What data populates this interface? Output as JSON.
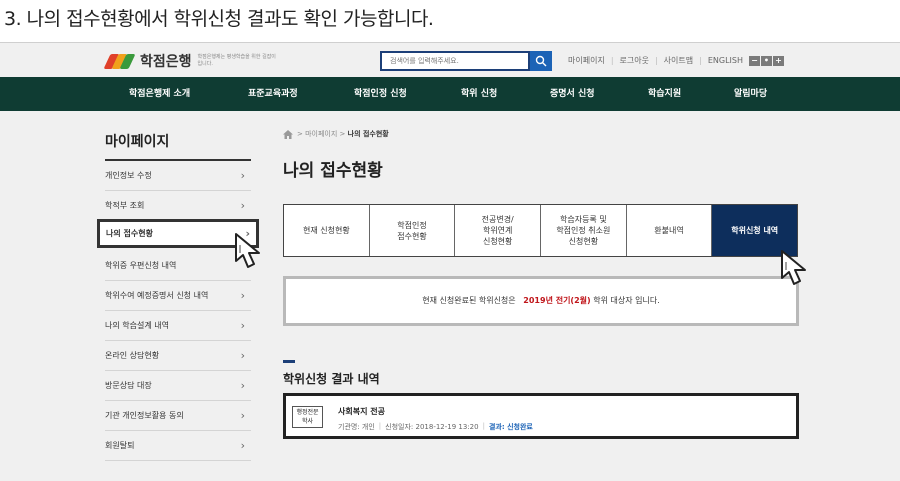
{
  "caption": "3. 나의 접수현황에서 학위신청 결과도 확인 가능합니다.",
  "header": {
    "logo": "학점은행",
    "logo_sub": "학점은행제는 평생학습을 위한 길잡이 입니다.",
    "search_placeholder": "검색어를 입력해주세요.",
    "util": [
      "마이페이지",
      "로그아웃",
      "사이트맵",
      "ENGLISH"
    ],
    "zoom": [
      "−",
      "•",
      "+"
    ]
  },
  "nav": [
    "학점은행제 소개",
    "표준교육과정",
    "학점인정 신청",
    "학위 신청",
    "증명서 신청",
    "학습지원",
    "알림마당"
  ],
  "sidebar": {
    "title": "마이페이지",
    "items": [
      {
        "label": "개인정보 수정",
        "chev": "›"
      },
      {
        "label": "학적부 조회",
        "chev": "›"
      },
      {
        "label": "나의 접수현황",
        "chev": "›"
      },
      {
        "label": "학위증 우편신청 내역",
        "chev": ""
      },
      {
        "label": "학위수여 예정증명서 신청 내역",
        "chev": "›"
      },
      {
        "label": "나의 학습설계 내역",
        "chev": "›"
      },
      {
        "label": "온라인 상담현황",
        "chev": "›"
      },
      {
        "label": "방문상담 대장",
        "chev": "›"
      },
      {
        "label": "기관 개인정보활용 동의",
        "chev": "›"
      },
      {
        "label": "회원탈퇴",
        "chev": "›"
      }
    ]
  },
  "breadcrumb": {
    "sep": ">",
    "parent": "마이페이지",
    "current": "나의 접수현황"
  },
  "page_title": "나의 접수현황",
  "tabs": [
    "현재 신청현황",
    "학점인정\n접수현황",
    "전공변경/\n학위연계\n신청현황",
    "학습자등록 및\n학점인정 취소원\n신청현황",
    "환불내역",
    "학위신청 내역"
  ],
  "notice": {
    "prefix": "현재 신청완료된 학위신청은",
    "highlight": "2019년 전기(2월)",
    "suffix": "학위 대상자 입니다."
  },
  "result": {
    "title": "학위신청 결과 내역",
    "badge": "행정전문\n학사",
    "name": "사회복지 전공",
    "meta_institution": "기관명: 개인",
    "meta_date": "신청일자: 2018-12-19 13:20",
    "meta_result": "결과: 신청완료"
  },
  "colors": {
    "nav_bg": "#0f3c33",
    "active_tab": "#0d2e5c",
    "highlight": "#c0161b",
    "link_blue": "#1c63b6"
  }
}
